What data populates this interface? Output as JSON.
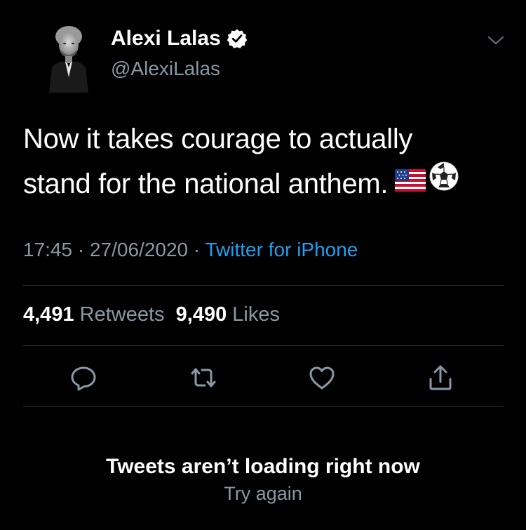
{
  "tweet": {
    "author_name": "Alexi Lalas",
    "handle": "@AlexiLalas",
    "verified": true,
    "text_line1": "Now it takes courage to actually",
    "text_line2": "stand for the national anthem.",
    "emojis": [
      "us-flag-icon",
      "soccer-ball-icon"
    ],
    "time": "17:45",
    "separator": " · ",
    "date": "27/06/2020",
    "source": "Twitter for iPhone"
  },
  "stats": {
    "retweets_count": "4,491",
    "retweets_label": "Retweets",
    "likes_count": "9,490",
    "likes_label": "Likes"
  },
  "actions": [
    "reply-icon",
    "retweet-icon",
    "like-icon",
    "share-icon"
  ],
  "empty_state": {
    "title": "Tweets aren’t loading right now",
    "retry_label": "Try again"
  },
  "colors": {
    "background": "#000000",
    "text": "#ffffff",
    "secondary": "#8899a6",
    "link": "#1da1f2",
    "divider": "#2f3336"
  }
}
